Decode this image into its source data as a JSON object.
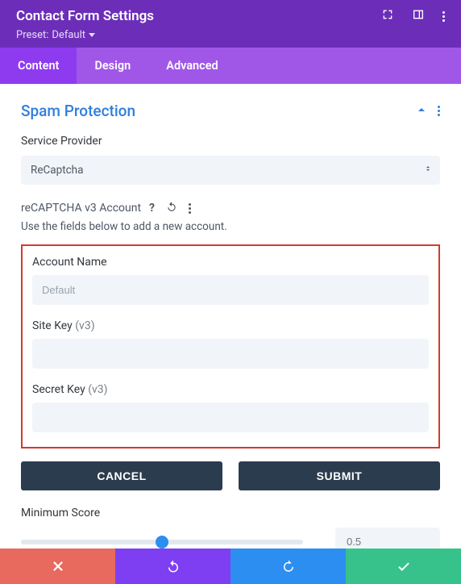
{
  "header": {
    "title": "Contact Form Settings",
    "preset_label": "Preset:",
    "preset_value": "Default"
  },
  "tabs": {
    "content": "Content",
    "design": "Design",
    "advanced": "Advanced"
  },
  "section": {
    "title": "Spam Protection"
  },
  "service_provider": {
    "label": "Service Provider",
    "value": "ReCaptcha"
  },
  "account": {
    "heading": "reCAPTCHA v3 Account",
    "hint": "Use the fields below to add a new account.",
    "name_label": "Account Name",
    "name_placeholder": "Default",
    "site_key_label": "Site Key",
    "secret_key_label": "Secret Key",
    "v3_suffix": "(v3)"
  },
  "buttons": {
    "cancel": "CANCEL",
    "submit": "SUBMIT"
  },
  "score": {
    "label": "Minimum Score",
    "value": "0.5"
  }
}
